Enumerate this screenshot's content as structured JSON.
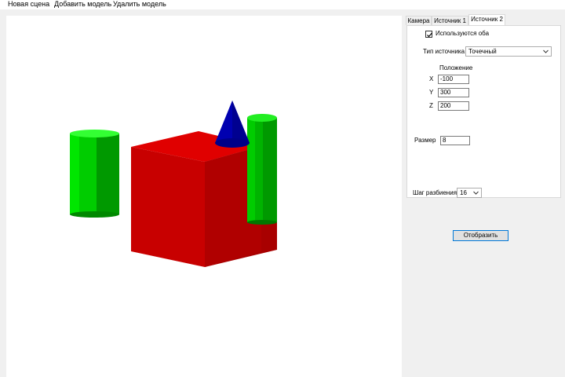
{
  "menu": {
    "new_scene": "Новая сцена",
    "add_model": "Добавить модель",
    "delete_model": "Удалить модель"
  },
  "tabs": [
    {
      "label": "Камера",
      "active": false
    },
    {
      "label": "Источник 1",
      "active": false
    },
    {
      "label": "Источник 2",
      "active": true
    }
  ],
  "source_panel": {
    "use_both_label": "Используются оба",
    "use_both_checked": true,
    "source_type_label": "Тип источника",
    "source_type_value": "Точечный",
    "position_label": "Положение",
    "x_label": "X",
    "x_value": "-100",
    "y_label": "Y",
    "y_value": "300",
    "z_label": "Z",
    "z_value": "200",
    "size_label": "Размер",
    "size_value": "8"
  },
  "split_step": {
    "label": "Шаг разбиения",
    "value": "16"
  },
  "render_button": "Отобразить",
  "scene": {
    "objects": [
      "green-cylinder",
      "red-cube",
      "green-cylinder",
      "blue-cone"
    ],
    "colors": {
      "red": "#cc0000",
      "green": "#00cc00",
      "blue": "#0000aa"
    }
  }
}
